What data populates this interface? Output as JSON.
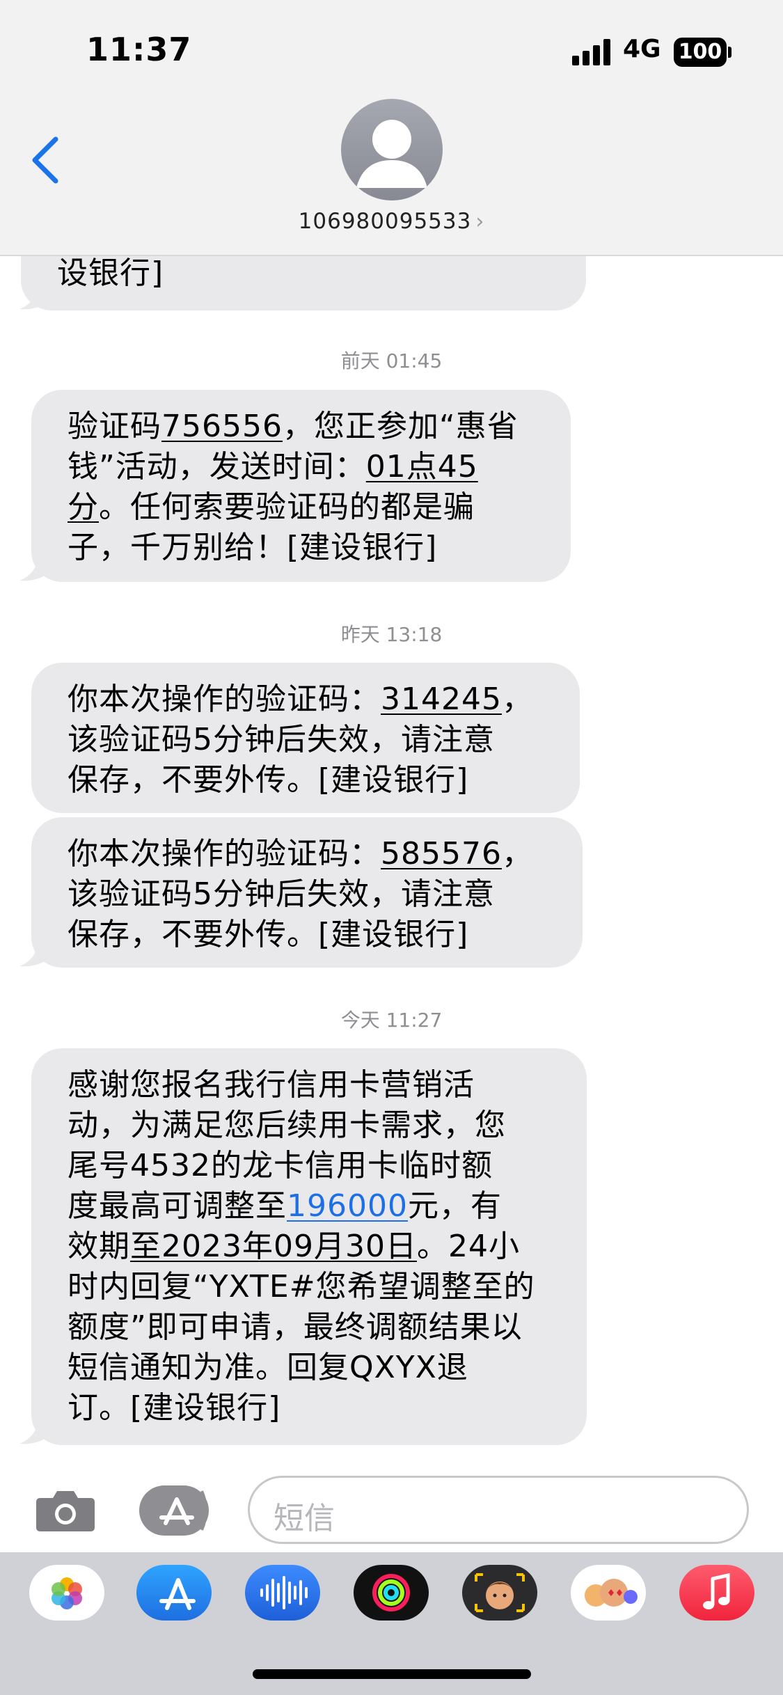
{
  "status": {
    "time": "11:37",
    "network": "4G",
    "battery": "100"
  },
  "contact": {
    "name": "106980095533"
  },
  "messages": {
    "prev_tail": "设银行]",
    "ts1": {
      "day": "前天",
      "time": "01:45"
    },
    "m1": {
      "a": "验证码",
      "code": "756556",
      "b": "，您正参加“惠省",
      "c": "钱”活动，发送时间：",
      "time1": "01点45",
      "time2": "分",
      "d": "。任何索要验证码的都是骗",
      "e": "子，千万别给！[建设银行]"
    },
    "ts2": {
      "day": "昨天",
      "time": "13:18"
    },
    "m2": {
      "a": "你本次操作的验证码：",
      "code": "314245",
      "b": "，",
      "c": "该验证码5分钟后失效，请注意",
      "d": "保存，不要外传。[建设银行]"
    },
    "m3": {
      "a": "你本次操作的验证码：",
      "code": "585576",
      "b": "，",
      "c": "该验证码5分钟后失效，请注意",
      "d": "保存，不要外传。[建设银行]"
    },
    "ts3": {
      "day": "今天",
      "time": "11:27"
    },
    "m4": {
      "l1": "感谢您报名我行信用卡营销活",
      "l2": "动，为满足您后续用卡需求，您",
      "l3": "尾号4532的龙卡信用卡临时额",
      "l4a": "度最高可调整至",
      "amount": "196000",
      "l4b": "元，有",
      "l5a": "效期",
      "date": "至2023年09月30日",
      "l5b": "。24小",
      "l6": "时内回复“YXTE#您希望调整至的",
      "l7": "额度”即可申请，最终调额结果以",
      "l8": "短信通知为准。回复QXYX退",
      "l9": "订。[建设银行]"
    }
  },
  "input": {
    "placeholder": "短信"
  },
  "dock": [
    "photos-app",
    "app-store-app",
    "audio-app",
    "fitness-app",
    "memoji-app",
    "memoji-stickers-app",
    "music-app"
  ]
}
